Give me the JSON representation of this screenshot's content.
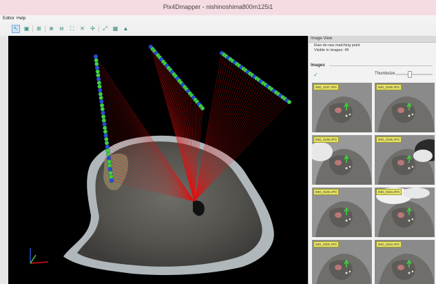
{
  "window": {
    "title": "Pix4Dmapper - nishinoshima800m125i1"
  },
  "menu": [
    "Editor",
    "Help"
  ],
  "toolbar": {
    "icons": [
      "select-icon",
      "box-icon",
      "layers-icon",
      "zoom-in-icon",
      "zoom-out-icon",
      "fit-view-icon",
      "cross-icon",
      "move-icon",
      "expand-icon",
      "grid-icon",
      "up-icon"
    ]
  },
  "image_view": {
    "title": "Image View",
    "line1": "Raw de-raw matching point",
    "line2": "Visible in images:  49"
  },
  "images": {
    "label": "Images",
    "thumbsize_label": "Thumbsize",
    "slider_fraction": 0.38,
    "thumbnails": [
      {
        "label": "IMG_0197.JPG",
        "variant": "a"
      },
      {
        "label": "IMG_0196.JPG",
        "variant": "b"
      },
      {
        "label": "IMG_0198.JPG",
        "variant": "c"
      },
      {
        "label": "IMG_0195.JPG",
        "variant": "d"
      },
      {
        "label": "IMG_0199.JPG",
        "variant": "e"
      },
      {
        "label": "IMG_0194.JPG",
        "variant": "f"
      },
      {
        "label": "IMG_0200.JPG",
        "variant": "a"
      },
      {
        "label": "IMG_0193.JPG",
        "variant": "b"
      }
    ]
  },
  "colors": {
    "ray": "#e01010",
    "camera_green": "#3fd23a",
    "camera_blue": "#2a4fd8",
    "title_bar": "#f5dce3"
  }
}
